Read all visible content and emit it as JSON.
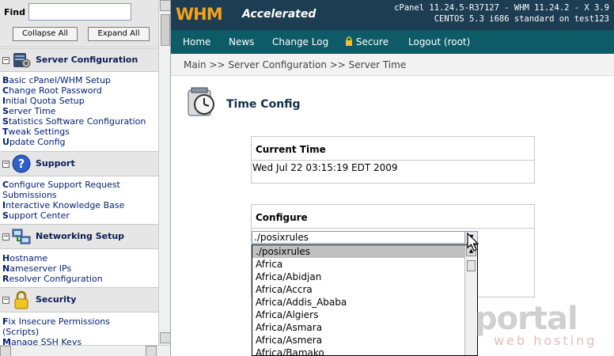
{
  "sidebar": {
    "find_label": "Find",
    "find_value": "",
    "collapse_label": "Collapse All",
    "expand_label": "Expand All",
    "sections": [
      {
        "title": "Server Configuration",
        "icon": "server-config-icon",
        "links": [
          {
            "first": "B",
            "rest": "asic cPanel/WHM Setup"
          },
          {
            "first": "C",
            "rest": "hange Root Password"
          },
          {
            "first": "I",
            "rest": "nitial Quota Setup"
          },
          {
            "first": "S",
            "rest": "erver Time"
          },
          {
            "first": "S",
            "rest": "tatistics Software Configuration"
          },
          {
            "first": "T",
            "rest": "weak Settings"
          },
          {
            "first": "U",
            "rest": "pdate Config"
          }
        ]
      },
      {
        "title": "Support",
        "icon": "help-icon",
        "links": [
          {
            "first": "C",
            "rest": "onfigure Support Request"
          },
          {
            "first": "",
            "rest": "Submissions"
          },
          {
            "first": "I",
            "rest": "nteractive Knowledge Base"
          },
          {
            "first": "S",
            "rest": "upport Center"
          }
        ]
      },
      {
        "title": "Networking Setup",
        "icon": "network-icon",
        "links": [
          {
            "first": "H",
            "rest": "ostname"
          },
          {
            "first": "N",
            "rest": "ameserver IPs"
          },
          {
            "first": "R",
            "rest": "esolver Configuration"
          }
        ]
      },
      {
        "title": "Security",
        "icon": "lock-icon",
        "links": [
          {
            "first": "F",
            "rest": "ix Insecure Permissions"
          },
          {
            "first": "",
            "rest": "(Scripts)"
          },
          {
            "first": "M",
            "rest": "anage SSH Keys"
          }
        ]
      }
    ]
  },
  "header": {
    "logo_main": "WHM",
    "logo_sub": "Accelerated",
    "version_line1": "cPanel 11.24.5-R37127 - WHM 11.24.2 - X 3.9",
    "version_line2": "CENTOS 5.3 i686 standard on test123"
  },
  "nav": {
    "home": "Home",
    "news": "News",
    "changelog": "Change Log",
    "secure": "Secure",
    "logout": "Logout (root)"
  },
  "breadcrumb": "Main >> Server Configuration >> Server Time",
  "page": {
    "title": "Time Config",
    "current_time_heading": "Current Time",
    "current_time_value": "Wed Jul 22 03:15:19 EDT 2009",
    "configure_heading": "Configure",
    "timezone_selected": "./posixrules",
    "timezone_options": [
      "./posixrules",
      "Africa",
      "Africa/Abidjan",
      "Africa/Accra",
      "Africa/Addis_Ababa",
      "Africa/Algiers",
      "Africa/Asmara",
      "Africa/Asmera",
      "Africa/Bamako"
    ]
  },
  "watermark": {
    "main": "portal",
    "sub": "web hosting"
  },
  "colors": {
    "topbar": "#1d3d52",
    "navbar": "#0d5b67",
    "logo_orange": "#f5a21b",
    "link_blue": "#001f77"
  }
}
